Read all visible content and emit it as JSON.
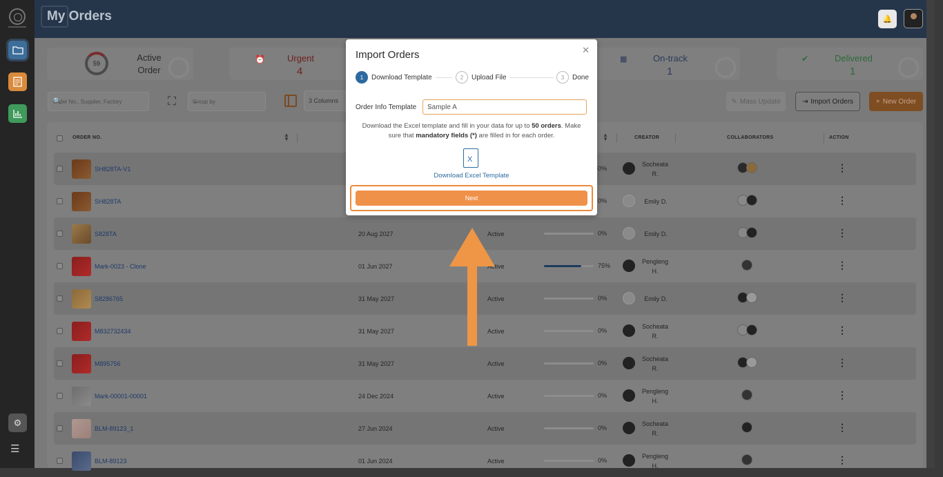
{
  "header": {
    "title": "My Orders"
  },
  "summary": {
    "active_value": "59",
    "active_label": "Active Order",
    "urgent_label": "Urgent",
    "urgent_value": "4",
    "ontrack_label": "On-track",
    "ontrack_value": "1",
    "delivered_label": "Delivered",
    "delivered_value": "1"
  },
  "toolbar": {
    "search_placeholder": "Order No., Supplier, Factory",
    "groupby_placeholder": "Group by",
    "columns_label": "3 Columns",
    "mass_update_label": "Mass Update",
    "import_orders_label": "Import Orders",
    "new_order_label": "New Order"
  },
  "table": {
    "headers": {
      "order_no": "ORDER NO.",
      "creator": "CREATOR",
      "collaborators": "COLLABORATORS",
      "action": "ACTION"
    },
    "rows": [
      {
        "order_no": "SH828TA-V1",
        "date": "",
        "status": "",
        "progress": 0,
        "progress_label": "0%",
        "creator": "Socheata R.",
        "thumb": "boot"
      },
      {
        "order_no": "SH828TA",
        "date": "",
        "status": "",
        "progress": 0,
        "progress_label": "0%",
        "creator": "Emily D.",
        "thumb": "boot"
      },
      {
        "order_no": "S828TA",
        "date": "20 Aug 2027",
        "status": "Active",
        "progress": 0,
        "progress_label": "0%",
        "creator": "Emily D.",
        "thumb": "bag"
      },
      {
        "order_no": "Mark-0023 - Clone",
        "date": "01 Jun 2027",
        "status": "Active",
        "progress": 75,
        "progress_label": "75%",
        "creator": "Pengleng H.",
        "thumb": "shirt-red"
      },
      {
        "order_no": "S8286765",
        "date": "31 May 2027",
        "status": "Active",
        "progress": 0,
        "progress_label": "0%",
        "creator": "Emily D.",
        "thumb": "coat"
      },
      {
        "order_no": "M832732434",
        "date": "31 May 2027",
        "status": "Active",
        "progress": 0,
        "progress_label": "0%",
        "creator": "Socheata R.",
        "thumb": "shirt-red"
      },
      {
        "order_no": "M895756",
        "date": "31 May 2027",
        "status": "Active",
        "progress": 0,
        "progress_label": "0%",
        "creator": "Socheata R.",
        "thumb": "shirt-red"
      },
      {
        "order_no": "Mark-00001-00001",
        "date": "24 Dec 2024",
        "status": "Active",
        "progress": 0,
        "progress_label": "0%",
        "creator": "Pengleng H.",
        "thumb": "placeholder"
      },
      {
        "order_no": "BLM-89123_1",
        "date": "27 Jun 2024",
        "status": "Active",
        "progress": 0,
        "progress_label": "0%",
        "creator": "Socheata R.",
        "thumb": "blouse"
      },
      {
        "order_no": "BLM-89123",
        "date": "01 Jun 2024",
        "status": "Active",
        "progress": 0,
        "progress_label": "0%",
        "creator": "Pengleng H.",
        "thumb": "plaid"
      }
    ]
  },
  "modal": {
    "title": "Import Orders",
    "steps": [
      {
        "num": "1",
        "label": "Download Template"
      },
      {
        "num": "2",
        "label": "Upload File"
      },
      {
        "num": "3",
        "label": "Done"
      }
    ],
    "field_label": "Order Info Template",
    "field_value": "Sample A",
    "desc_1": "Download the Excel template and fill in your data for up to ",
    "desc_bold_1": "50 orders",
    "desc_2": ". Make sure that ",
    "desc_bold_2": "mandatory fields (*)",
    "desc_3": " are filled in for each order.",
    "download_label": "Download Excel Template",
    "next_label": "Next"
  },
  "colors": {
    "accent_orange": "#f0914a",
    "primary_blue": "#2c6aa0",
    "header_navy": "#25364a"
  }
}
